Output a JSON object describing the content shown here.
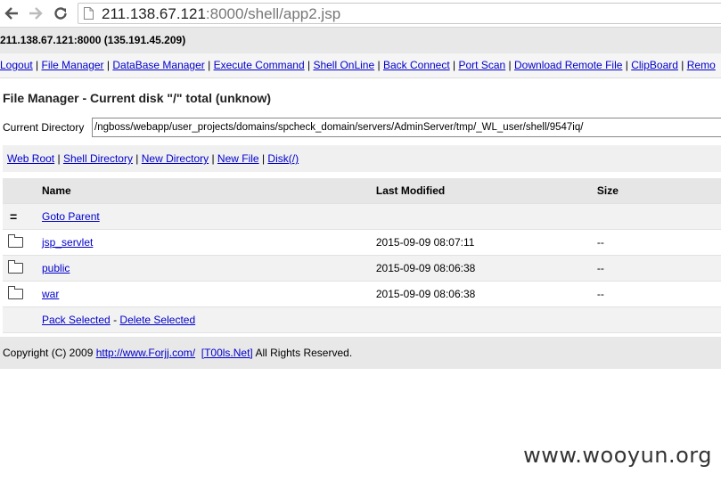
{
  "browser": {
    "url_host": "211.138.67.121",
    "url_rest": ":8000/shell/app2.jsp"
  },
  "hostbar": {
    "text": "211.138.67.121:8000 (135.191.45.209)"
  },
  "menu": [
    "Logout",
    "File Manager",
    "DataBase Manager",
    "Execute Command",
    "Shell OnLine",
    "Back Connect",
    "Port Scan",
    "Download Remote File",
    "ClipBoard",
    "Remo"
  ],
  "title": "File Manager - Current disk \"/\" total (unknow)",
  "current_directory": {
    "label": "Current Directory",
    "value": "/ngboss/webapp/user_projects/domains/spcheck_domain/servers/AdminServer/tmp/_WL_user/shell/9547iq/"
  },
  "quick_links": [
    "Web Root",
    "Shell Directory",
    "New Directory",
    "New File",
    "Disk(/)"
  ],
  "table": {
    "headers": {
      "name": "Name",
      "modified": "Last Modified",
      "size": "Size"
    },
    "parent": {
      "icon": "=",
      "label": "Goto Parent"
    },
    "rows": [
      {
        "name": "jsp_servlet",
        "modified": "2015-09-09 08:07:11",
        "size": "--",
        "icon": "folder-icon"
      },
      {
        "name": "public",
        "modified": "2015-09-09 08:06:38",
        "size": "--",
        "icon": "folder-icon"
      },
      {
        "name": "war",
        "modified": "2015-09-09 08:06:38",
        "size": "--",
        "icon": "folder-icon"
      }
    ],
    "actions": {
      "pack": "Pack Selected",
      "sep": "-",
      "delete": "Delete Selected"
    }
  },
  "footer": {
    "prefix": "Copyright (C) 2009 ",
    "link1": "http://www.Forjj.com/",
    "link2": "[T00ls.Net]",
    "suffix": " All Rights Reserved."
  },
  "watermark": "www.wooyun.org"
}
